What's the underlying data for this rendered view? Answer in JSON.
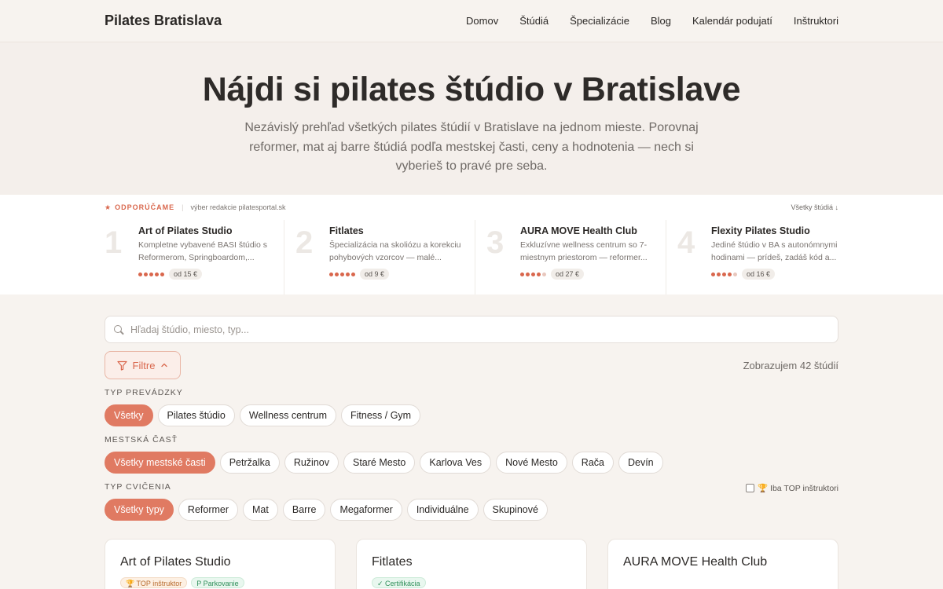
{
  "header": {
    "brand": "Pilates Bratislava",
    "nav": [
      "Domov",
      "Štúdiá",
      "Špecializácie",
      "Blog",
      "Kalendár podujatí",
      "Inštruktori"
    ]
  },
  "hero": {
    "title": "Nájdi si pilates štúdio v Bratislave",
    "subtitle": "Nezávislý prehľad všetkých pilates štúdií v Bratislave na jednom mieste. Porovnaj reformer, mat aj barre štúdiá podľa mestskej časti, ceny a hodnotenia — nech si vyberieš to pravé pre seba."
  },
  "recommended": {
    "label": "ODPORÚČAME",
    "sub": "výber redakcie pilatesportal.sk",
    "all_link": "Všetky štúdiá ↓",
    "items": [
      {
        "num": "1",
        "name": "Art of Pilates Studio",
        "desc": "Kompletne vybavené BASI štúdio s Reformerom, Springboardom,...",
        "rating": 5,
        "price": "od 15 €"
      },
      {
        "num": "2",
        "name": "Fitlates",
        "desc": "Špecializácia na skoliózu a korekciu pohybových vzorcov — malé...",
        "rating": 5,
        "price": "od 9 €"
      },
      {
        "num": "3",
        "name": "AURA MOVE Health Club",
        "desc": "Exkluzívne wellness centrum so 7-miestnym priestorom — reformer...",
        "rating": 4,
        "price": "od 27 €"
      },
      {
        "num": "4",
        "name": "Flexity Pilates Studio",
        "desc": "Jediné štúdio v BA s autonómnymi hodinami — prídeš, zadáš kód a...",
        "rating": 4,
        "price": "od 16 €"
      }
    ]
  },
  "search": {
    "placeholder": "Hľadaj štúdio, miesto, typ..."
  },
  "filters": {
    "button": "Filtre",
    "count": "Zobrazujem 42 štúdií",
    "type_label": "TYP PREVÁDZKY",
    "type_chips": [
      "Všetky",
      "Pilates štúdio",
      "Wellness centrum",
      "Fitness / Gym"
    ],
    "district_label": "MESTSKÁ ČASŤ",
    "district_chips": [
      "Všetky mestské časti",
      "Petržalka",
      "Ružinov",
      "Staré Mesto",
      "Karlova Ves",
      "Nové Mesto",
      "Rača",
      "Devín"
    ],
    "exercise_label": "TYP CVIČENIA",
    "exercise_chips": [
      "Všetky typy",
      "Reformer",
      "Mat",
      "Barre",
      "Megaformer",
      "Individuálne",
      "Skupinové"
    ],
    "top_only": "🏆 Iba TOP inštruktori"
  },
  "cards": [
    {
      "title": "Art of Pilates Studio",
      "badges": [
        {
          "kind": "top",
          "text": "🏆 TOP inštruktor"
        },
        {
          "kind": "park",
          "text": "P Parkovanie"
        }
      ]
    },
    {
      "title": "Fitlates",
      "badges": [
        {
          "kind": "cert",
          "text": "✓ Certifikácia"
        }
      ]
    },
    {
      "title": "AURA MOVE Health Club",
      "badges": []
    }
  ],
  "colors": {
    "accent": "#e07a62",
    "accent_text": "#d9674d"
  }
}
